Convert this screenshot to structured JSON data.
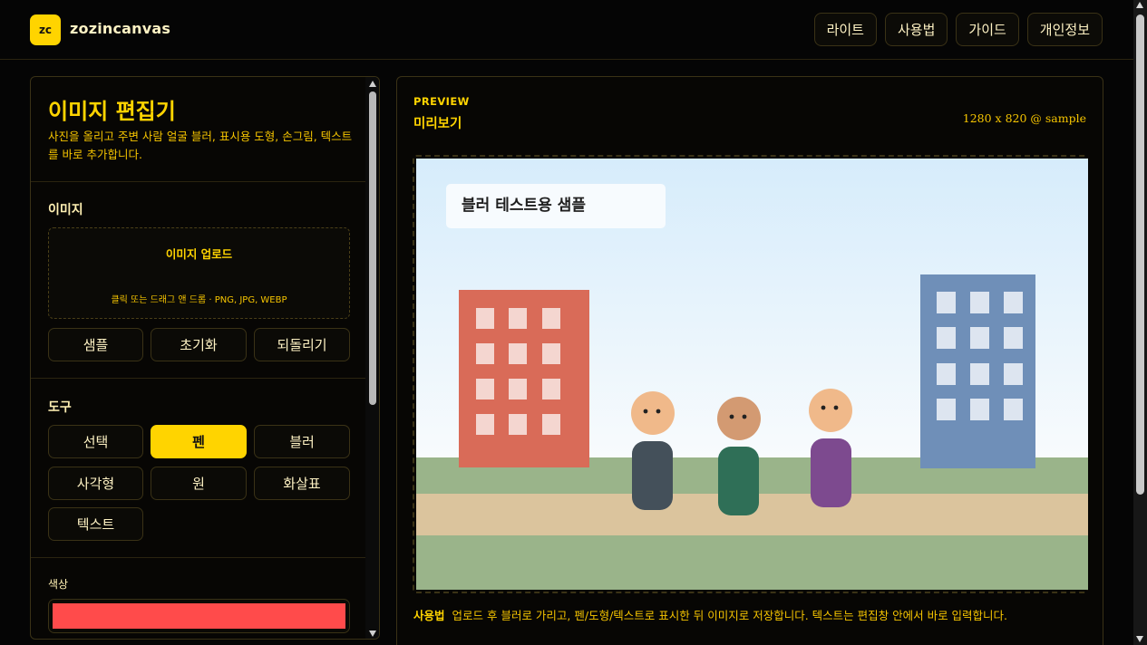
{
  "header": {
    "logo": "zc",
    "brand": "zozincanvas",
    "nav": [
      "라이트",
      "사용법",
      "가이드",
      "개인정보"
    ]
  },
  "editor": {
    "title": "이미지 편집기",
    "description": "사진을 올리고 주변 사람 얼굴 블러, 표시용 도형, 손그림, 텍스트를 바로 추가합니다.",
    "image_section": {
      "label": "이미지",
      "upload_title": "이미지 업로드",
      "upload_hint": "클릭 또는 드래그 앤 드롭 · PNG, JPG, WEBP",
      "buttons": [
        "샘플",
        "초기화",
        "되돌리기"
      ]
    },
    "tools_section": {
      "label": "도구",
      "tools": [
        "선택",
        "펜",
        "블러",
        "사각형",
        "원",
        "화살표",
        "텍스트"
      ],
      "active_tool": "펜"
    },
    "color_section": {
      "label": "색상",
      "value": "#ff4b4b"
    }
  },
  "preview": {
    "kicker": "PREVIEW",
    "title": "미리보기",
    "meta": "1280 x 820 @ sample",
    "canvas_label": "블러 테스트용 샘플",
    "usage_label": "사용법",
    "usage_text": "업로드 후 블러로 가리고, 펜/도형/텍스트로 표시한 뒤 이미지로 저장합니다. 텍스트는 편집창 안에서 바로 입력합니다."
  },
  "colors": {
    "accent": "#ffd400",
    "background": "#050505",
    "building_left": "#d96b58",
    "building_right": "#6f8fb8",
    "grass": "#9ab48a",
    "path": "#dbc49d"
  }
}
